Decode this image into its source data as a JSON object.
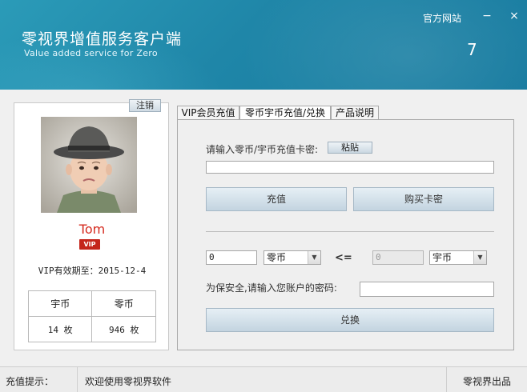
{
  "header": {
    "title": "零视界增值服务客户端",
    "subtitle": "Value added service for Zero",
    "official_link": "官方网站",
    "minimize": "−",
    "close": "×",
    "version": "7"
  },
  "user": {
    "logout_label": "注销",
    "name": "Tom",
    "vip_badge": "VIP",
    "expiry": "VIP有效期至：2015-12-4",
    "balances": {
      "col1_label": "宇币",
      "col2_label": "零币",
      "col1_value": "14 枚",
      "col2_value": "946 枚"
    }
  },
  "tabs": [
    {
      "label": "VIP会员充值",
      "active": false
    },
    {
      "label": "零币宇币充值/兑换",
      "active": true
    },
    {
      "label": "产品说明",
      "active": false
    }
  ],
  "recharge": {
    "card_label": "请输入零币/宇币充值卡密:",
    "paste_label": "粘贴",
    "card_value": "",
    "recharge_button": "充值",
    "buy_button": "购买卡密"
  },
  "exchange": {
    "amount_value": "0",
    "from_currency": "零币",
    "relation": "<=",
    "result_value": "0",
    "to_currency": "宇币",
    "password_label": "为保安全,请输入您账户的密码:",
    "password_value": "",
    "exchange_button": "兑换"
  },
  "status": {
    "label": "充值提示：",
    "message": "欢迎使用零视界软件",
    "vendor": "零视界出品"
  },
  "colors": {
    "header_bg": "#1f86a8",
    "username": "#d52a1e",
    "vip_badge": "#c4251b"
  }
}
